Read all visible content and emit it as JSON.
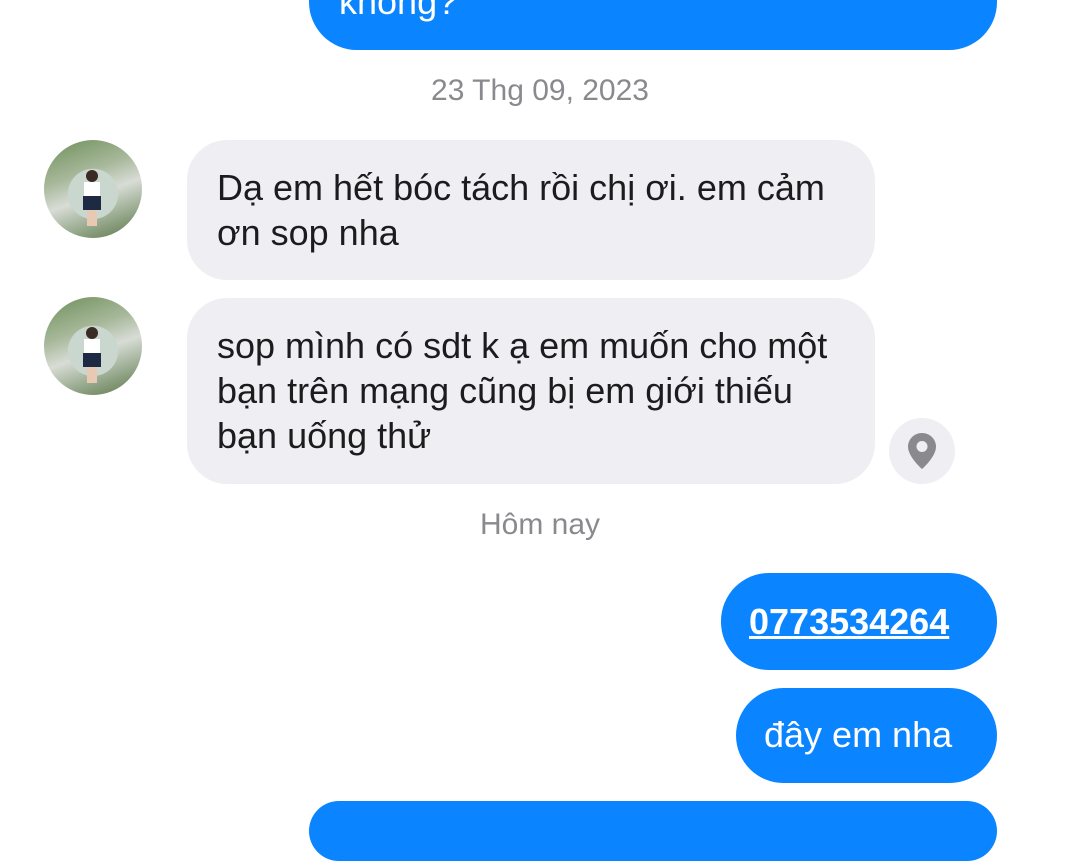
{
  "messages": {
    "top_outgoing": {
      "text": "không?"
    },
    "timestamp_1": "23 Thg 09, 2023",
    "incoming_1": {
      "text": "Dạ em hết bóc tách rồi chị ơi. em cảm ơn sop nha"
    },
    "incoming_2": {
      "text": "sop mình có sdt k ạ em muốn cho một bạn trên mạng cũng bị em giới thiếu bạn uống thử"
    },
    "timestamp_2": "Hôm nay",
    "outgoing_phone": {
      "text": "0773534264"
    },
    "outgoing_2": {
      "text": "đây em nha"
    }
  },
  "colors": {
    "outgoing_bubble": "#0a84ff",
    "incoming_bubble": "#efeff3",
    "timestamp_text": "#8a8a8e"
  },
  "icons": {
    "location": "map-pin-icon"
  }
}
